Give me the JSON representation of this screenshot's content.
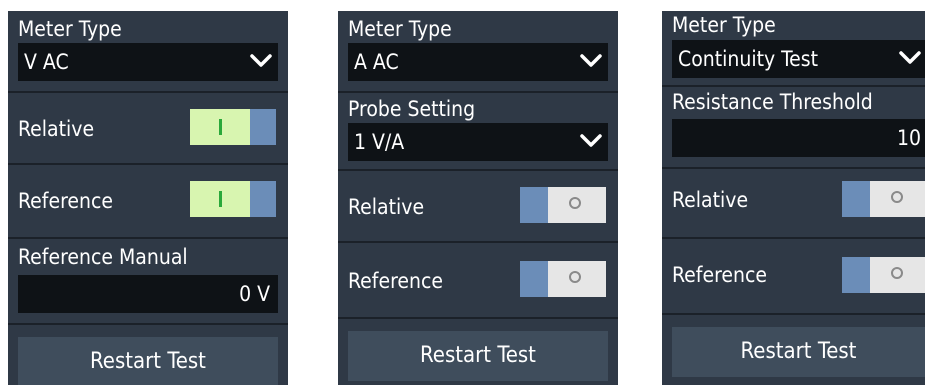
{
  "panel_v_ac": {
    "meter_type_label": "Meter Type",
    "meter_type_value": "V AC",
    "relative_label": "Relative",
    "relative_state": "on",
    "reference_label": "Reference",
    "reference_state": "on",
    "reference_manual_label": "Reference Manual",
    "reference_manual_value": "0 V",
    "restart_label": "Restart Test"
  },
  "panel_a_ac": {
    "meter_type_label": "Meter Type",
    "meter_type_value": "A AC",
    "probe_setting_label": "Probe Setting",
    "probe_setting_value": "1 V/A",
    "relative_label": "Relative",
    "relative_state": "off",
    "reference_label": "Reference",
    "reference_state": "off",
    "restart_label": "Restart Test"
  },
  "panel_continuity": {
    "meter_type_label": "Meter Type",
    "meter_type_value": "Continuity Test",
    "resistance_threshold_label": "Resistance Threshold",
    "resistance_threshold_value": "10",
    "relative_label": "Relative",
    "relative_state": "off",
    "reference_label": "Reference",
    "reference_state": "off",
    "restart_label": "Restart Test"
  },
  "colors": {
    "panel_bg": "#2f3946",
    "field_bg": "#0e1216",
    "toggle_on": "#d8f5b0",
    "toggle_on_mark": "#2aa83a",
    "toggle_blue": "#6b8db8",
    "toggle_off": "#e6e6e6",
    "button_bg": "#3f4d5c"
  },
  "icons": [
    "chevron-down-icon",
    "toggle-on-mark",
    "toggle-off-circle"
  ]
}
